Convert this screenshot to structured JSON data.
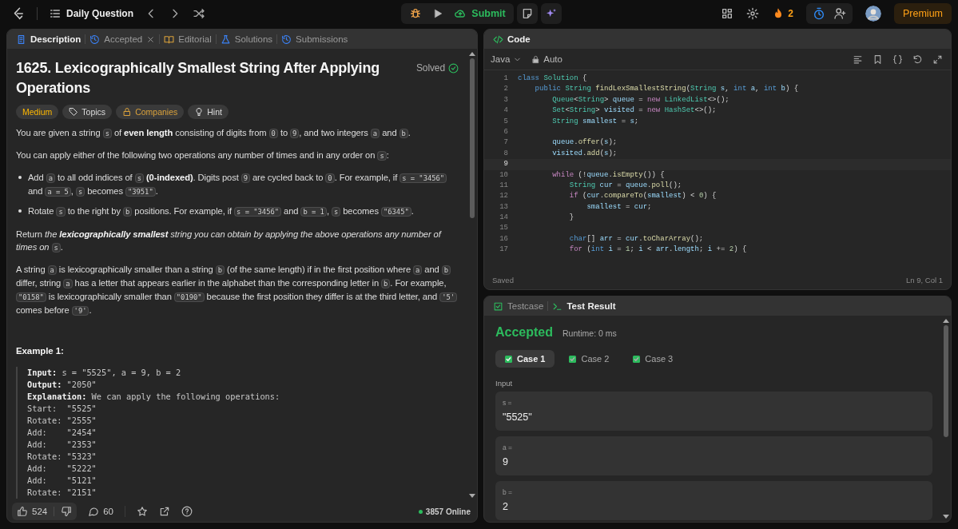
{
  "top_bar": {
    "title": "Daily Question",
    "submit": "Submit",
    "streak": "2",
    "premium": "Premium"
  },
  "description_panel": {
    "tabs": [
      {
        "label": "Description",
        "selected": true,
        "closable": false
      },
      {
        "label": "Accepted",
        "selected": false,
        "closable": true
      },
      {
        "label": "Editorial",
        "selected": false,
        "closable": false
      },
      {
        "label": "Solutions",
        "selected": false,
        "closable": false
      },
      {
        "label": "Submissions",
        "selected": false,
        "closable": false
      }
    ],
    "title": "1625. Lexicographically Smallest String After Applying Operations",
    "status": "Solved",
    "tags": [
      {
        "label": "Medium",
        "kind": "difficulty"
      },
      {
        "label": "Topics",
        "kind": "topics"
      },
      {
        "label": "Companies",
        "kind": "locked"
      },
      {
        "label": "Hint",
        "kind": "hint"
      }
    ],
    "blocks": [
      {
        "kind": "paragraph",
        "segments": [
          {
            "kind": "text",
            "text": "You are given a string "
          },
          {
            "kind": "code",
            "text": "s"
          },
          {
            "kind": "text",
            "text": " of "
          },
          {
            "kind": "bold",
            "text": "even length"
          },
          {
            "kind": "text",
            "text": " consisting of digits from "
          },
          {
            "kind": "code",
            "text": "0"
          },
          {
            "kind": "text",
            "text": " to "
          },
          {
            "kind": "code",
            "text": "9"
          },
          {
            "kind": "text",
            "text": ", and two integers "
          },
          {
            "kind": "code",
            "text": "a"
          },
          {
            "kind": "text",
            "text": " and "
          },
          {
            "kind": "code",
            "text": "b"
          },
          {
            "kind": "text",
            "text": "."
          }
        ]
      },
      {
        "kind": "paragraph",
        "segments": [
          {
            "kind": "text",
            "text": "You can apply either of the following two operations any number of times and in any order on "
          },
          {
            "kind": "code",
            "text": "s"
          },
          {
            "kind": "text",
            "text": ":"
          }
        ]
      },
      {
        "kind": "bullets",
        "items": [
          {
            "segments": [
              {
                "kind": "text",
                "text": "Add "
              },
              {
                "kind": "code",
                "text": "a"
              },
              {
                "kind": "text",
                "text": " to all odd indices of "
              },
              {
                "kind": "code",
                "text": "s"
              },
              {
                "kind": "bold",
                "text": " (0-indexed)"
              },
              {
                "kind": "text",
                "text": ". Digits post "
              },
              {
                "kind": "code",
                "text": "9"
              },
              {
                "kind": "text",
                "text": " are cycled back to "
              },
              {
                "kind": "code",
                "text": "0"
              },
              {
                "kind": "text",
                "text": ". For example, if "
              },
              {
                "kind": "code",
                "text": "s = \"3456\""
              },
              {
                "kind": "text",
                "text": " and "
              },
              {
                "kind": "code",
                "text": "a = 5"
              },
              {
                "kind": "text",
                "text": ", "
              },
              {
                "kind": "code",
                "text": "s"
              },
              {
                "kind": "text",
                "text": " becomes "
              },
              {
                "kind": "code",
                "text": "\"3951\""
              },
              {
                "kind": "text",
                "text": "."
              }
            ]
          },
          {
            "segments": [
              {
                "kind": "text",
                "text": "Rotate "
              },
              {
                "kind": "code",
                "text": "s"
              },
              {
                "kind": "text",
                "text": " to the right by "
              },
              {
                "kind": "code",
                "text": "b"
              },
              {
                "kind": "text",
                "text": " positions. For example, if "
              },
              {
                "kind": "code",
                "text": "s = \"3456\""
              },
              {
                "kind": "text",
                "text": " and "
              },
              {
                "kind": "code",
                "text": "b = 1"
              },
              {
                "kind": "text",
                "text": ", "
              },
              {
                "kind": "code",
                "text": "s"
              },
              {
                "kind": "text",
                "text": " becomes "
              },
              {
                "kind": "code",
                "text": "\"6345\""
              },
              {
                "kind": "text",
                "text": "."
              }
            ]
          }
        ]
      },
      {
        "kind": "paragraph",
        "segments": [
          {
            "kind": "text",
            "text": "Return "
          },
          {
            "kind": "italic",
            "text": "the "
          },
          {
            "kind": "bold-italic",
            "text": "lexicographically smallest"
          },
          {
            "kind": "italic",
            "text": " string you can obtain by applying the above operations any number of times on "
          },
          {
            "kind": "code",
            "text": "s"
          },
          {
            "kind": "text",
            "text": "."
          }
        ]
      },
      {
        "kind": "paragraph",
        "segments": [
          {
            "kind": "text",
            "text": "A string "
          },
          {
            "kind": "code",
            "text": "a"
          },
          {
            "kind": "text",
            "text": " is lexicographically smaller than a string "
          },
          {
            "kind": "code",
            "text": "b"
          },
          {
            "kind": "text",
            "text": " (of the same length) if in the first position where "
          },
          {
            "kind": "code",
            "text": "a"
          },
          {
            "kind": "text",
            "text": " and "
          },
          {
            "kind": "code",
            "text": "b"
          },
          {
            "kind": "text",
            "text": " differ, string "
          },
          {
            "kind": "code",
            "text": "a"
          },
          {
            "kind": "text",
            "text": " has a letter that appears earlier in the alphabet than the corresponding letter in "
          },
          {
            "kind": "code",
            "text": "b"
          },
          {
            "kind": "text",
            "text": ". For example, "
          },
          {
            "kind": "code",
            "text": "\"0158\""
          },
          {
            "kind": "text",
            "text": " is lexicographically smaller than "
          },
          {
            "kind": "code",
            "text": "\"0190\""
          },
          {
            "kind": "text",
            "text": " because the first position they differ is at the third letter, and "
          },
          {
            "kind": "code",
            "text": "'5'"
          },
          {
            "kind": "text",
            "text": " comes before "
          },
          {
            "kind": "code",
            "text": "'9'"
          },
          {
            "kind": "text",
            "text": "."
          }
        ]
      }
    ],
    "example": {
      "heading": "Example 1:",
      "lines": [
        "**Input:** s = \"5525\", a = 9, b = 2",
        "**Output:** \"2050\"",
        "**Explanation:** We can apply the following operations:",
        "Start:  \"5525\"",
        "Rotate: \"2555\"",
        "Add:    \"2454\"",
        "Add:    \"2353\"",
        "Rotate: \"5323\"",
        "Add:    \"5222\"",
        "Add:    \"5121\"",
        "Rotate: \"2151\""
      ]
    },
    "footer": {
      "likes": "524",
      "comments": "60",
      "online": "3857 Online"
    }
  },
  "code_panel": {
    "title": "Code",
    "language": "Java",
    "mode": "Auto",
    "status": "Saved",
    "cursor": "Ln 9, Col 1",
    "lines": [
      {
        "number": "1",
        "current": false,
        "tokens": [
          {
            "kind": "keyword",
            "text": "class"
          },
          {
            "kind": "type",
            "text": " Solution"
          },
          {
            "kind": "plain",
            "text": " {"
          }
        ]
      },
      {
        "number": "2",
        "current": false,
        "tokens": [
          {
            "kind": "keyword",
            "text": "    public"
          },
          {
            "kind": "type",
            "text": " String"
          },
          {
            "kind": "function",
            "text": " findLexSmallestString"
          },
          {
            "kind": "plain",
            "text": "("
          },
          {
            "kind": "type",
            "text": "String"
          },
          {
            "kind": "variable",
            "text": " s"
          },
          {
            "kind": "plain",
            "text": ", "
          },
          {
            "kind": "keyword",
            "text": "int"
          },
          {
            "kind": "variable",
            "text": " a"
          },
          {
            "kind": "plain",
            "text": ", "
          },
          {
            "kind": "keyword",
            "text": "int"
          },
          {
            "kind": "variable",
            "text": " b"
          },
          {
            "kind": "plain",
            "text": ") {"
          }
        ]
      },
      {
        "number": "3",
        "current": false,
        "tokens": [
          {
            "kind": "type",
            "text": "        Queue"
          },
          {
            "kind": "plain",
            "text": "<"
          },
          {
            "kind": "type",
            "text": "String"
          },
          {
            "kind": "plain",
            "text": "> "
          },
          {
            "kind": "variable",
            "text": "queue"
          },
          {
            "kind": "plain",
            "text": " = "
          },
          {
            "kind": "control",
            "text": "new"
          },
          {
            "kind": "type",
            "text": " LinkedList"
          },
          {
            "kind": "plain",
            "text": "<>();"
          }
        ]
      },
      {
        "number": "4",
        "current": false,
        "tokens": [
          {
            "kind": "type",
            "text": "        Set"
          },
          {
            "kind": "plain",
            "text": "<"
          },
          {
            "kind": "type",
            "text": "String"
          },
          {
            "kind": "plain",
            "text": "> "
          },
          {
            "kind": "variable",
            "text": "visited"
          },
          {
            "kind": "plain",
            "text": " = "
          },
          {
            "kind": "control",
            "text": "new"
          },
          {
            "kind": "type",
            "text": " HashSet"
          },
          {
            "kind": "plain",
            "text": "<>();"
          }
        ]
      },
      {
        "number": "5",
        "current": false,
        "tokens": [
          {
            "kind": "type",
            "text": "        String"
          },
          {
            "kind": "variable",
            "text": " smallest"
          },
          {
            "kind": "plain",
            "text": " = "
          },
          {
            "kind": "variable",
            "text": "s"
          },
          {
            "kind": "plain",
            "text": ";"
          }
        ]
      },
      {
        "number": "6",
        "current": false
      },
      {
        "number": "7",
        "current": false,
        "tokens": [
          {
            "kind": "variable",
            "text": "        queue"
          },
          {
            "kind": "plain",
            "text": "."
          },
          {
            "kind": "function",
            "text": "offer"
          },
          {
            "kind": "plain",
            "text": "("
          },
          {
            "kind": "variable",
            "text": "s"
          },
          {
            "kind": "plain",
            "text": ");"
          }
        ]
      },
      {
        "number": "8",
        "current": false,
        "tokens": [
          {
            "kind": "variable",
            "text": "        visited"
          },
          {
            "kind": "plain",
            "text": "."
          },
          {
            "kind": "function",
            "text": "add"
          },
          {
            "kind": "plain",
            "text": "("
          },
          {
            "kind": "variable",
            "text": "s"
          },
          {
            "kind": "plain",
            "text": ");"
          }
        ]
      },
      {
        "number": "9",
        "current": true
      },
      {
        "number": "10",
        "current": false,
        "tokens": [
          {
            "kind": "control",
            "text": "        while"
          },
          {
            "kind": "plain",
            "text": " (!"
          },
          {
            "kind": "variable",
            "text": "queue"
          },
          {
            "kind": "plain",
            "text": "."
          },
          {
            "kind": "function",
            "text": "isEmpty"
          },
          {
            "kind": "plain",
            "text": "()) {"
          }
        ]
      },
      {
        "number": "11",
        "current": false,
        "tokens": [
          {
            "kind": "type",
            "text": "            String"
          },
          {
            "kind": "variable",
            "text": " cur"
          },
          {
            "kind": "plain",
            "text": " = "
          },
          {
            "kind": "variable",
            "text": "queue"
          },
          {
            "kind": "plain",
            "text": "."
          },
          {
            "kind": "function",
            "text": "poll"
          },
          {
            "kind": "plain",
            "text": "();"
          }
        ]
      },
      {
        "number": "12",
        "current": false,
        "tokens": [
          {
            "kind": "control",
            "text": "            if"
          },
          {
            "kind": "plain",
            "text": " ("
          },
          {
            "kind": "variable",
            "text": "cur"
          },
          {
            "kind": "plain",
            "text": "."
          },
          {
            "kind": "function",
            "text": "compareTo"
          },
          {
            "kind": "plain",
            "text": "("
          },
          {
            "kind": "variable",
            "text": "smallest"
          },
          {
            "kind": "plain",
            "text": ") < "
          },
          {
            "kind": "number",
            "text": "0"
          },
          {
            "kind": "plain",
            "text": ") {"
          }
        ]
      },
      {
        "number": "13",
        "current": false,
        "tokens": [
          {
            "kind": "variable",
            "text": "                smallest"
          },
          {
            "kind": "plain",
            "text": " = "
          },
          {
            "kind": "variable",
            "text": "cur"
          },
          {
            "kind": "plain",
            "text": ";"
          }
        ]
      },
      {
        "number": "14",
        "current": false,
        "tokens": [
          {
            "kind": "plain",
            "text": "            }"
          }
        ]
      },
      {
        "number": "15",
        "current": false
      },
      {
        "number": "16",
        "current": false,
        "tokens": [
          {
            "kind": "keyword",
            "text": "            char"
          },
          {
            "kind": "plain",
            "text": "[] "
          },
          {
            "kind": "variable",
            "text": "arr"
          },
          {
            "kind": "plain",
            "text": " = "
          },
          {
            "kind": "variable",
            "text": "cur"
          },
          {
            "kind": "plain",
            "text": "."
          },
          {
            "kind": "function",
            "text": "toCharArray"
          },
          {
            "kind": "plain",
            "text": "();"
          }
        ]
      },
      {
        "number": "17",
        "current": false,
        "tokens": [
          {
            "kind": "control",
            "text": "            for"
          },
          {
            "kind": "plain",
            "text": " ("
          },
          {
            "kind": "keyword",
            "text": "int"
          },
          {
            "kind": "variable",
            "text": " i"
          },
          {
            "kind": "plain",
            "text": " = "
          },
          {
            "kind": "number",
            "text": "1"
          },
          {
            "kind": "plain",
            "text": "; "
          },
          {
            "kind": "variable",
            "text": "i"
          },
          {
            "kind": "plain",
            "text": " < "
          },
          {
            "kind": "variable",
            "text": "arr"
          },
          {
            "kind": "plain",
            "text": "."
          },
          {
            "kind": "variable",
            "text": "length"
          },
          {
            "kind": "plain",
            "text": "; "
          },
          {
            "kind": "variable",
            "text": "i"
          },
          {
            "kind": "plain",
            "text": " += "
          },
          {
            "kind": "number",
            "text": "2"
          },
          {
            "kind": "plain",
            "text": ") {"
          }
        ]
      }
    ]
  },
  "test_panel": {
    "tabs": [
      {
        "label": "Testcase",
        "selected": false
      },
      {
        "label": "Test Result",
        "selected": true
      }
    ],
    "verdict": "Accepted",
    "runtime": "Runtime: 0 ms",
    "cases": [
      {
        "label": "Case 1",
        "selected": true,
        "passed": true
      },
      {
        "label": "Case 2",
        "selected": false,
        "passed": true
      },
      {
        "label": "Case 3",
        "selected": false,
        "passed": true
      }
    ],
    "input_label": "Input",
    "inputs": [
      {
        "name": "s =",
        "value": "\"5525\""
      },
      {
        "name": "a =",
        "value": "9"
      },
      {
        "name": "b =",
        "value": "2"
      }
    ]
  }
}
